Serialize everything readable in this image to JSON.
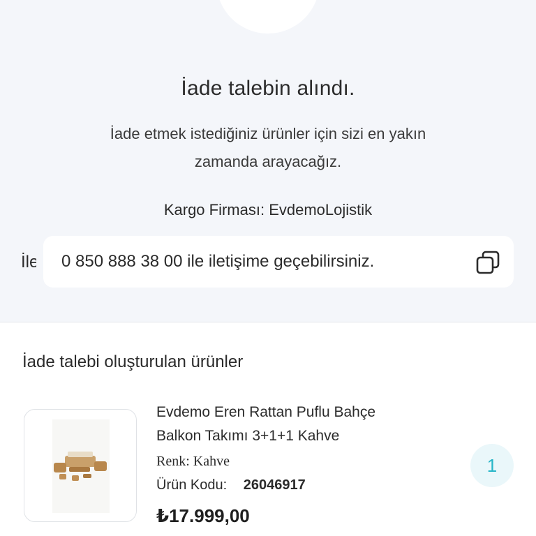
{
  "return_status": {
    "title": "İade talebin alındı.",
    "description_line1": "İade etmek istediğiniz ürünler için sizi en yakın",
    "description_line2": "zamanda arayacağız.",
    "cargo": "Kargo Firması: EvdemoLojistik",
    "contact_peek": "İletişim",
    "contact_text": "0 850 888 38 00 ile iletişime geçebilirsiniz."
  },
  "products_section": {
    "title": "İade talebi oluşturulan ürünler",
    "items": [
      {
        "name_line1": "Evdemo Eren Rattan Puflu Bahçe",
        "name_line2": "Balkon Takımı 3+1+1 Kahve",
        "color": "Renk: Kahve",
        "code_label": "Ürün Kodu:",
        "code_value": "26046917",
        "price": "₺17.999,00",
        "quantity": "1"
      }
    ]
  },
  "icons": {
    "copy": "copy-icon"
  },
  "colors": {
    "top_background": "#f4f6fa",
    "accent": "#28b6c8",
    "badge_background": "#eaf7fa"
  }
}
